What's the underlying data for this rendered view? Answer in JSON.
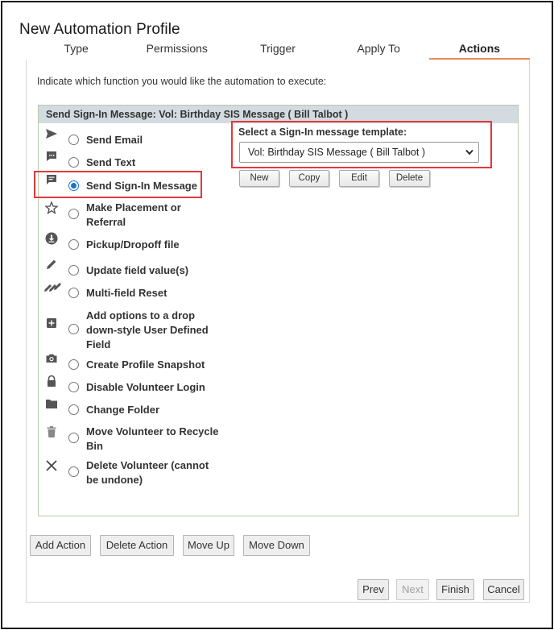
{
  "title": "New Automation Profile",
  "tabs": [
    {
      "label": "Type",
      "active": false
    },
    {
      "label": "Permissions",
      "active": false
    },
    {
      "label": "Trigger",
      "active": false
    },
    {
      "label": "Apply To",
      "active": false
    },
    {
      "label": "Actions",
      "active": true
    }
  ],
  "instruction": "Indicate which function you would like the automation to execute:",
  "panel": {
    "header": "Send Sign-In Message: Vol: Birthday SIS Message ( Bill Talbot )",
    "options": [
      {
        "label": "Send Email",
        "icon": "send-icon",
        "checked": false
      },
      {
        "label": "Send Text",
        "icon": "chat-icon",
        "checked": false
      },
      {
        "label": "Send Sign-In Message",
        "icon": "message-icon",
        "checked": true
      },
      {
        "label": "Make Placement or Referral",
        "icon": "star-icon",
        "checked": false
      },
      {
        "label": "Pickup/Dropoff file",
        "icon": "download-icon",
        "checked": false
      },
      {
        "label": "Update field value(s)",
        "icon": "pencil-icon",
        "checked": false
      },
      {
        "label": "Multi-field Reset",
        "icon": "multi-pencil-icon",
        "checked": false
      },
      {
        "label": "Add options to a drop down-style User Defined Field",
        "icon": "plus-box-icon",
        "checked": false
      },
      {
        "label": "Create Profile Snapshot",
        "icon": "camera-icon",
        "checked": false
      },
      {
        "label": "Disable Volunteer Login",
        "icon": "lock-icon",
        "checked": false
      },
      {
        "label": "Change Folder",
        "icon": "folder-icon",
        "checked": false
      },
      {
        "label": "Move Volunteer to Recycle Bin",
        "icon": "trash-icon",
        "checked": false
      },
      {
        "label": "Delete Volunteer (cannot be undone)",
        "icon": "x-icon",
        "checked": false
      }
    ],
    "template_label": "Select a Sign-In message template:",
    "template_value": "Vol: Birthday SIS Message ( Bill Talbot )",
    "template_buttons": [
      "New",
      "Copy",
      "Edit",
      "Delete"
    ]
  },
  "action_buttons": [
    "Add Action",
    "Delete Action",
    "Move Up",
    "Move Down"
  ],
  "nav_buttons": {
    "prev": "Prev",
    "next": "Next",
    "finish": "Finish",
    "cancel": "Cancel"
  },
  "colors": {
    "active_tab_underline": "#f08a5a",
    "highlight": "#e0393e",
    "radio_selected": "#1a73c8",
    "panel_header_bg": "#d3dbe0"
  }
}
